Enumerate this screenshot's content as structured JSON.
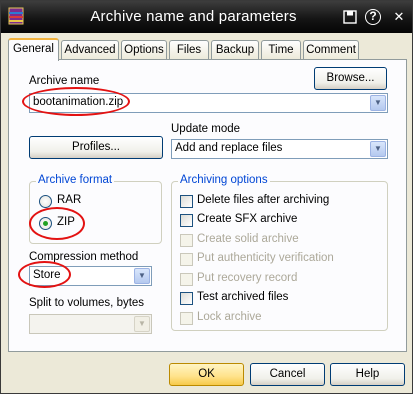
{
  "window": {
    "title": "Archive name and parameters",
    "icon": "winrar-icon",
    "controls": {
      "save": "save-icon",
      "help": "?",
      "close": "✕"
    }
  },
  "tabs": [
    "General",
    "Advanced",
    "Options",
    "Files",
    "Backup",
    "Time",
    "Comment"
  ],
  "archive_name": {
    "label": "Archive name",
    "value": "bootanimation.zip",
    "browse_label": "Browse..."
  },
  "profiles": {
    "label": "Profiles..."
  },
  "update_mode": {
    "label": "Update mode",
    "value": "Add and replace files"
  },
  "archive_format": {
    "title": "Archive format",
    "options": [
      "RAR",
      "ZIP"
    ],
    "selected": "ZIP"
  },
  "compression": {
    "label": "Compression method",
    "value": "Store"
  },
  "split": {
    "label": "Split to volumes, bytes",
    "value": ""
  },
  "archiving_options": {
    "title": "Archiving options",
    "items": [
      {
        "label": "Delete files after archiving",
        "checked": false,
        "enabled": true
      },
      {
        "label": "Create SFX archive",
        "checked": false,
        "enabled": true
      },
      {
        "label": "Create solid archive",
        "checked": false,
        "enabled": false
      },
      {
        "label": "Put authenticity verification",
        "checked": false,
        "enabled": false
      },
      {
        "label": "Put recovery record",
        "checked": false,
        "enabled": false
      },
      {
        "label": "Test archived files",
        "checked": false,
        "enabled": true
      },
      {
        "label": "Lock archive",
        "checked": false,
        "enabled": false
      }
    ]
  },
  "buttons": {
    "ok": "OK",
    "cancel": "Cancel",
    "help": "Help"
  },
  "annotation_color": "#e31212"
}
